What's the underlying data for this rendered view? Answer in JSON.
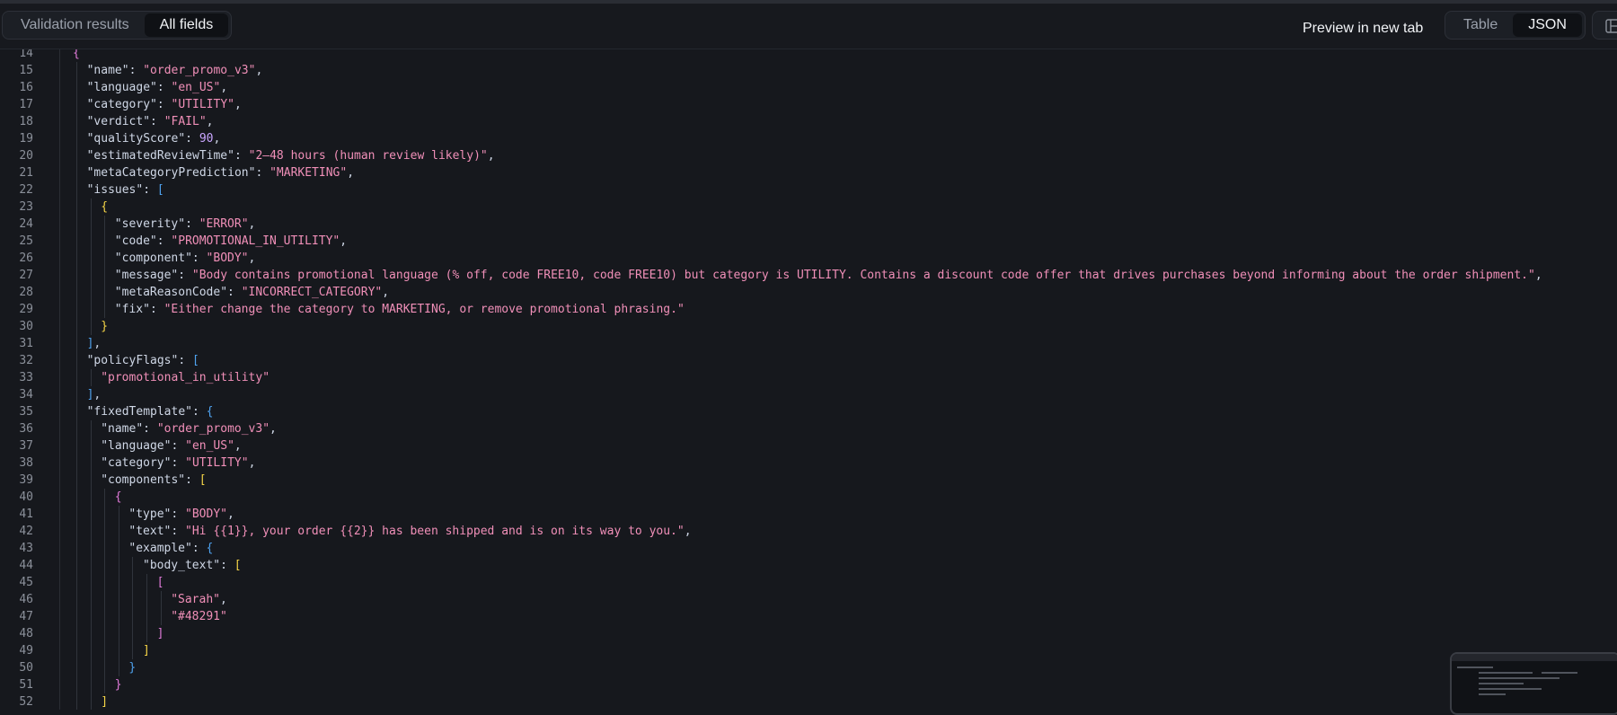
{
  "toolbar": {
    "left_tabs": [
      {
        "label": "Validation results",
        "active": false
      },
      {
        "label": "All fields",
        "active": true
      }
    ],
    "preview_label": "Preview in new tab",
    "view_tabs": [
      {
        "label": "Table",
        "active": false
      },
      {
        "label": "JSON",
        "active": true
      }
    ]
  },
  "colors": {
    "key": "#cfd7e6",
    "string": "#f08fb8",
    "number": "#c9a6ff",
    "bracket_level_1": "#e07ad9",
    "bracket_level_2": "#f5d547",
    "bracket_level_3": "#4fa3f0"
  },
  "editor": {
    "lines": [
      {
        "n": "14",
        "d": 0,
        "t": [
          [
            "{",
            "b1"
          ]
        ]
      },
      {
        "n": "15",
        "d": 1,
        "t": [
          [
            "\"name\"",
            "k"
          ],
          [
            ": ",
            "p"
          ],
          [
            "\"order_promo_v3\"",
            "s"
          ],
          [
            ",",
            "p"
          ]
        ]
      },
      {
        "n": "16",
        "d": 1,
        "t": [
          [
            "\"language\"",
            "k"
          ],
          [
            ": ",
            "p"
          ],
          [
            "\"en_US\"",
            "s"
          ],
          [
            ",",
            "p"
          ]
        ]
      },
      {
        "n": "17",
        "d": 1,
        "t": [
          [
            "\"category\"",
            "k"
          ],
          [
            ": ",
            "p"
          ],
          [
            "\"UTILITY\"",
            "s"
          ],
          [
            ",",
            "p"
          ]
        ]
      },
      {
        "n": "18",
        "d": 1,
        "t": [
          [
            "\"verdict\"",
            "k"
          ],
          [
            ": ",
            "p"
          ],
          [
            "\"FAIL\"",
            "s"
          ],
          [
            ",",
            "p"
          ]
        ]
      },
      {
        "n": "19",
        "d": 1,
        "t": [
          [
            "\"qualityScore\"",
            "k"
          ],
          [
            ": ",
            "p"
          ],
          [
            "90",
            "n"
          ],
          [
            ",",
            "p"
          ]
        ]
      },
      {
        "n": "20",
        "d": 1,
        "t": [
          [
            "\"estimatedReviewTime\"",
            "k"
          ],
          [
            ": ",
            "p"
          ],
          [
            "\"2–48 hours (human review likely)\"",
            "s"
          ],
          [
            ",",
            "p"
          ]
        ]
      },
      {
        "n": "21",
        "d": 1,
        "t": [
          [
            "\"metaCategoryPrediction\"",
            "k"
          ],
          [
            ": ",
            "p"
          ],
          [
            "\"MARKETING\"",
            "s"
          ],
          [
            ",",
            "p"
          ]
        ]
      },
      {
        "n": "22",
        "d": 1,
        "t": [
          [
            "\"issues\"",
            "k"
          ],
          [
            ": ",
            "p"
          ],
          [
            "[",
            "b3"
          ]
        ]
      },
      {
        "n": "23",
        "d": 2,
        "t": [
          [
            "{",
            "b2"
          ]
        ]
      },
      {
        "n": "24",
        "d": 3,
        "t": [
          [
            "\"severity\"",
            "k"
          ],
          [
            ": ",
            "p"
          ],
          [
            "\"ERROR\"",
            "s"
          ],
          [
            ",",
            "p"
          ]
        ]
      },
      {
        "n": "25",
        "d": 3,
        "t": [
          [
            "\"code\"",
            "k"
          ],
          [
            ": ",
            "p"
          ],
          [
            "\"PROMOTIONAL_IN_UTILITY\"",
            "s"
          ],
          [
            ",",
            "p"
          ]
        ]
      },
      {
        "n": "26",
        "d": 3,
        "t": [
          [
            "\"component\"",
            "k"
          ],
          [
            ": ",
            "p"
          ],
          [
            "\"BODY\"",
            "s"
          ],
          [
            ",",
            "p"
          ]
        ]
      },
      {
        "n": "27",
        "d": 3,
        "t": [
          [
            "\"message\"",
            "k"
          ],
          [
            ": ",
            "p"
          ],
          [
            "\"Body contains promotional language (% off, code FREE10, code FREE10) but category is UTILITY. Contains a discount code offer that drives purchases beyond informing about the order shipment.\"",
            "s"
          ],
          [
            ",",
            "p"
          ]
        ]
      },
      {
        "n": "28",
        "d": 3,
        "t": [
          [
            "\"metaReasonCode\"",
            "k"
          ],
          [
            ": ",
            "p"
          ],
          [
            "\"INCORRECT_CATEGORY\"",
            "s"
          ],
          [
            ",",
            "p"
          ]
        ]
      },
      {
        "n": "29",
        "d": 3,
        "t": [
          [
            "\"fix\"",
            "k"
          ],
          [
            ": ",
            "p"
          ],
          [
            "\"Either change the category to MARKETING, or remove promotional phrasing.\"",
            "s"
          ]
        ]
      },
      {
        "n": "30",
        "d": 2,
        "t": [
          [
            "}",
            "b2"
          ]
        ]
      },
      {
        "n": "31",
        "d": 1,
        "t": [
          [
            "]",
            "b3"
          ],
          [
            ",",
            "p"
          ]
        ]
      },
      {
        "n": "32",
        "d": 1,
        "t": [
          [
            "\"policyFlags\"",
            "k"
          ],
          [
            ": ",
            "p"
          ],
          [
            "[",
            "b3"
          ]
        ]
      },
      {
        "n": "33",
        "d": 2,
        "t": [
          [
            "\"promotional_in_utility\"",
            "s"
          ]
        ]
      },
      {
        "n": "34",
        "d": 1,
        "t": [
          [
            "]",
            "b3"
          ],
          [
            ",",
            "p"
          ]
        ]
      },
      {
        "n": "35",
        "d": 1,
        "t": [
          [
            "\"fixedTemplate\"",
            "k"
          ],
          [
            ": ",
            "p"
          ],
          [
            "{",
            "b3"
          ]
        ]
      },
      {
        "n": "36",
        "d": 2,
        "t": [
          [
            "\"name\"",
            "k"
          ],
          [
            ": ",
            "p"
          ],
          [
            "\"order_promo_v3\"",
            "s"
          ],
          [
            ",",
            "p"
          ]
        ]
      },
      {
        "n": "37",
        "d": 2,
        "t": [
          [
            "\"language\"",
            "k"
          ],
          [
            ": ",
            "p"
          ],
          [
            "\"en_US\"",
            "s"
          ],
          [
            ",",
            "p"
          ]
        ]
      },
      {
        "n": "38",
        "d": 2,
        "t": [
          [
            "\"category\"",
            "k"
          ],
          [
            ": ",
            "p"
          ],
          [
            "\"UTILITY\"",
            "s"
          ],
          [
            ",",
            "p"
          ]
        ]
      },
      {
        "n": "39",
        "d": 2,
        "t": [
          [
            "\"components\"",
            "k"
          ],
          [
            ": ",
            "p"
          ],
          [
            "[",
            "b2"
          ]
        ]
      },
      {
        "n": "40",
        "d": 3,
        "t": [
          [
            "{",
            "b1"
          ]
        ]
      },
      {
        "n": "41",
        "d": 4,
        "t": [
          [
            "\"type\"",
            "k"
          ],
          [
            ": ",
            "p"
          ],
          [
            "\"BODY\"",
            "s"
          ],
          [
            ",",
            "p"
          ]
        ]
      },
      {
        "n": "42",
        "d": 4,
        "t": [
          [
            "\"text\"",
            "k"
          ],
          [
            ": ",
            "p"
          ],
          [
            "\"Hi {{1}}, your order {{2}} has been shipped and is on its way to you.\"",
            "s"
          ],
          [
            ",",
            "p"
          ]
        ]
      },
      {
        "n": "43",
        "d": 4,
        "t": [
          [
            "\"example\"",
            "k"
          ],
          [
            ": ",
            "p"
          ],
          [
            "{",
            "b3"
          ]
        ]
      },
      {
        "n": "44",
        "d": 5,
        "t": [
          [
            "\"body_text\"",
            "k"
          ],
          [
            ": ",
            "p"
          ],
          [
            "[",
            "b2"
          ]
        ]
      },
      {
        "n": "45",
        "d": 6,
        "t": [
          [
            "[",
            "b1"
          ]
        ]
      },
      {
        "n": "46",
        "d": 7,
        "t": [
          [
            "\"Sarah\"",
            "s"
          ],
          [
            ",",
            "p"
          ]
        ]
      },
      {
        "n": "47",
        "d": 7,
        "t": [
          [
            "\"#48291\"",
            "s"
          ]
        ]
      },
      {
        "n": "48",
        "d": 6,
        "t": [
          [
            "]",
            "b1"
          ]
        ]
      },
      {
        "n": "49",
        "d": 5,
        "t": [
          [
            "]",
            "b2"
          ]
        ]
      },
      {
        "n": "50",
        "d": 4,
        "t": [
          [
            "}",
            "b3"
          ]
        ]
      },
      {
        "n": "51",
        "d": 3,
        "t": [
          [
            "}",
            "b1"
          ]
        ]
      },
      {
        "n": "52",
        "d": 2,
        "t": [
          [
            "]",
            "b2"
          ]
        ]
      }
    ]
  }
}
